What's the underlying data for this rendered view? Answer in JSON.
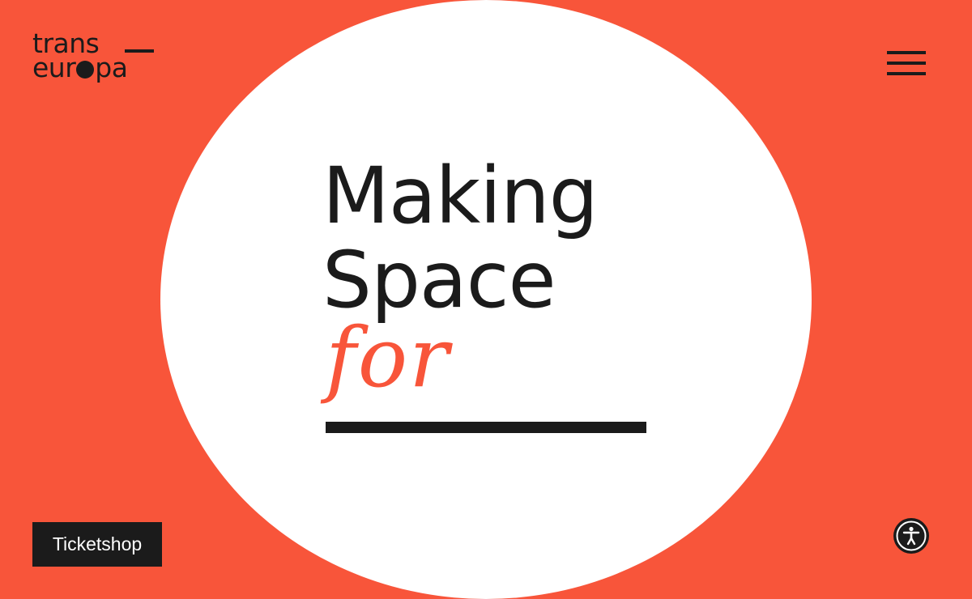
{
  "logo": {
    "line1": "trans",
    "line2_left": "eur",
    "line2_right": "pa"
  },
  "header": {
    "menu_icon": "hamburger-menu-icon"
  },
  "hero": {
    "line1": "Making",
    "line2": "Space",
    "script_word": "for"
  },
  "footer": {
    "ticket_label": "Ticketshop",
    "accessibility_icon": "accessibility-icon"
  },
  "colors": {
    "background": "#f8553a",
    "circle": "#ffffff",
    "ink": "#1b1b1b",
    "accent": "#f8553a"
  }
}
